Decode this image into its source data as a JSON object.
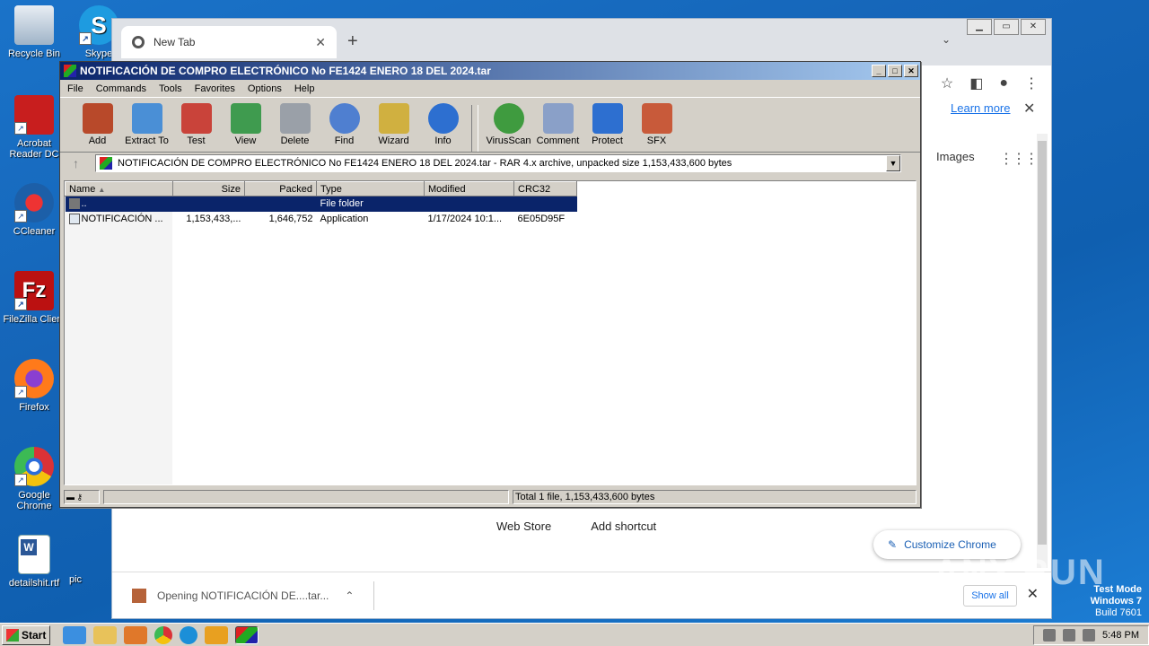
{
  "desktop": {
    "icons": [
      {
        "label": "Recycle Bin"
      },
      {
        "label": "Skype"
      },
      {
        "label": "Acrobat Reader DC"
      },
      {
        "label": "CCleaner"
      },
      {
        "label": "FileZilla Client"
      },
      {
        "label": "Firefox"
      },
      {
        "label": "Google Chrome"
      },
      {
        "label": "detailshit.rtf"
      },
      {
        "label": "pic"
      }
    ]
  },
  "chrome": {
    "tab_title": "New Tab",
    "learn_more": "Learn more",
    "images": "Images",
    "links": [
      "Web Store",
      "Add shortcut"
    ],
    "customize": "Customize Chrome",
    "download_label": "Opening NOTIFICACIÓN DE....tar...",
    "show_all": "Show all"
  },
  "winrar": {
    "title": "NOTIFICACIÓN DE COMPRO ELECTRÓNICO No FE1424 ENERO 18 DEL 2024.tar",
    "menu": [
      "File",
      "Commands",
      "Tools",
      "Favorites",
      "Options",
      "Help"
    ],
    "tools": [
      {
        "label": "Add",
        "color": "#b8492a"
      },
      {
        "label": "Extract To",
        "color": "#4a8fd6"
      },
      {
        "label": "Test",
        "color": "#c9433a"
      },
      {
        "label": "View",
        "color": "#3f9b4f"
      },
      {
        "label": "Delete",
        "color": "#9aa0a8"
      },
      {
        "label": "Find",
        "color": "#4f7fd0"
      },
      {
        "label": "Wizard",
        "color": "#d0b040"
      },
      {
        "label": "Info",
        "color": "#2d6fd0"
      }
    ],
    "tools2": [
      {
        "label": "VirusScan",
        "color": "#3f9b3f"
      },
      {
        "label": "Comment",
        "color": "#8aa0c8"
      },
      {
        "label": "Protect",
        "color": "#2d6fd0"
      },
      {
        "label": "SFX",
        "color": "#c85a3a"
      }
    ],
    "path": "NOTIFICACIÓN DE COMPRO ELECTRÓNICO No FE1424 ENERO 18 DEL 2024.tar - RAR 4.x archive, unpacked size 1,153,433,600 bytes",
    "columns": [
      "Name",
      "Size",
      "Packed",
      "Type",
      "Modified",
      "CRC32"
    ],
    "rows": [
      {
        "name": "..",
        "size": "",
        "packed": "",
        "type": "File folder",
        "modified": "",
        "crc": ""
      },
      {
        "name": "NOTIFICACIÓN ...",
        "size": "1,153,433,...",
        "packed": "1,646,752",
        "type": "Application",
        "modified": "1/17/2024 10:1...",
        "crc": "6E05D95F"
      }
    ],
    "status": "Total 1 file, 1,153,433,600 bytes"
  },
  "taskbar": {
    "start": "Start",
    "clock": "5:48 PM"
  },
  "watermark": {
    "line1": "Test Mode",
    "line2": "Windows 7",
    "line3": "Build 7601",
    "brand": "ANY.RUN"
  }
}
